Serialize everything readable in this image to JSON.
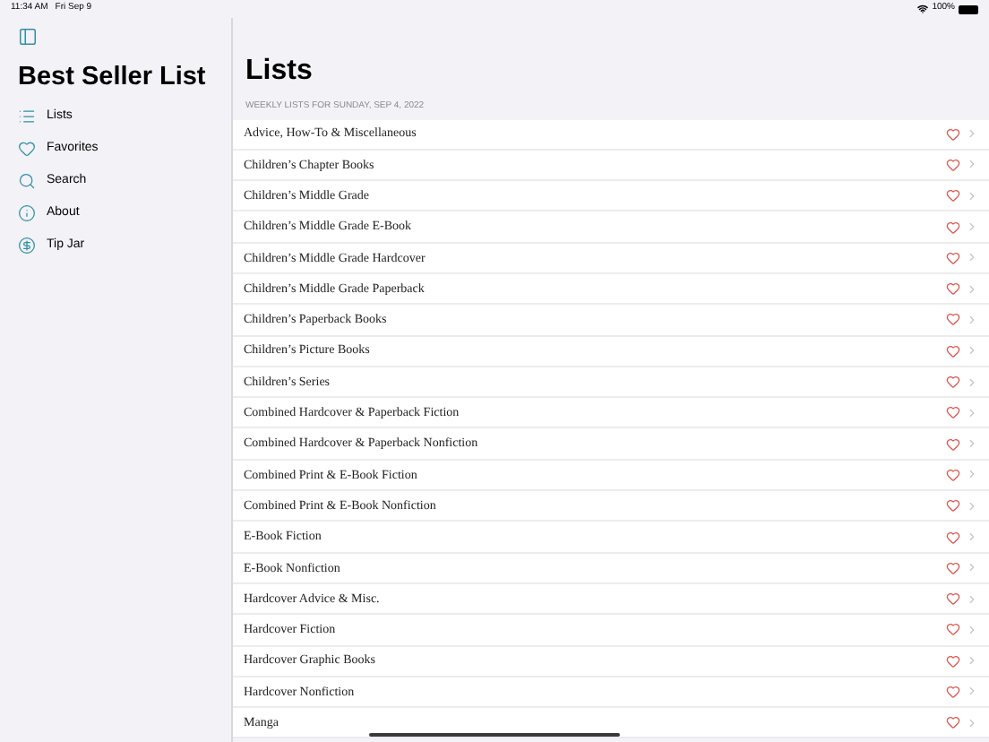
{
  "status_bar": {
    "time": "11:34 AM",
    "date": "Fri Sep 9",
    "battery": "100%"
  },
  "sidebar": {
    "title": "Best Seller List",
    "items": [
      {
        "label": "Lists"
      },
      {
        "label": "Favorites"
      },
      {
        "label": "Search"
      },
      {
        "label": "About"
      },
      {
        "label": "Tip Jar"
      }
    ]
  },
  "main": {
    "title": "Lists",
    "section_header": "WEEKLY LISTS FOR SUNDAY, SEP 4, 2022",
    "rows": [
      "Advice, How-To & Miscellaneous",
      "Children’s Chapter Books",
      "Children’s Middle Grade",
      "Children’s Middle Grade E-Book",
      "Children’s Middle Grade Hardcover",
      "Children’s Middle Grade Paperback",
      "Children’s Paperback Books",
      "Children’s Picture Books",
      "Children’s Series",
      "Combined Hardcover & Paperback Fiction",
      "Combined Hardcover & Paperback Nonfiction",
      "Combined Print & E-Book Fiction",
      "Combined Print & E-Book Nonfiction",
      "E-Book Fiction",
      "E-Book Nonfiction",
      "Hardcover Advice & Misc.",
      "Hardcover Fiction",
      "Hardcover Graphic Books",
      "Hardcover Nonfiction",
      "Manga"
    ]
  }
}
